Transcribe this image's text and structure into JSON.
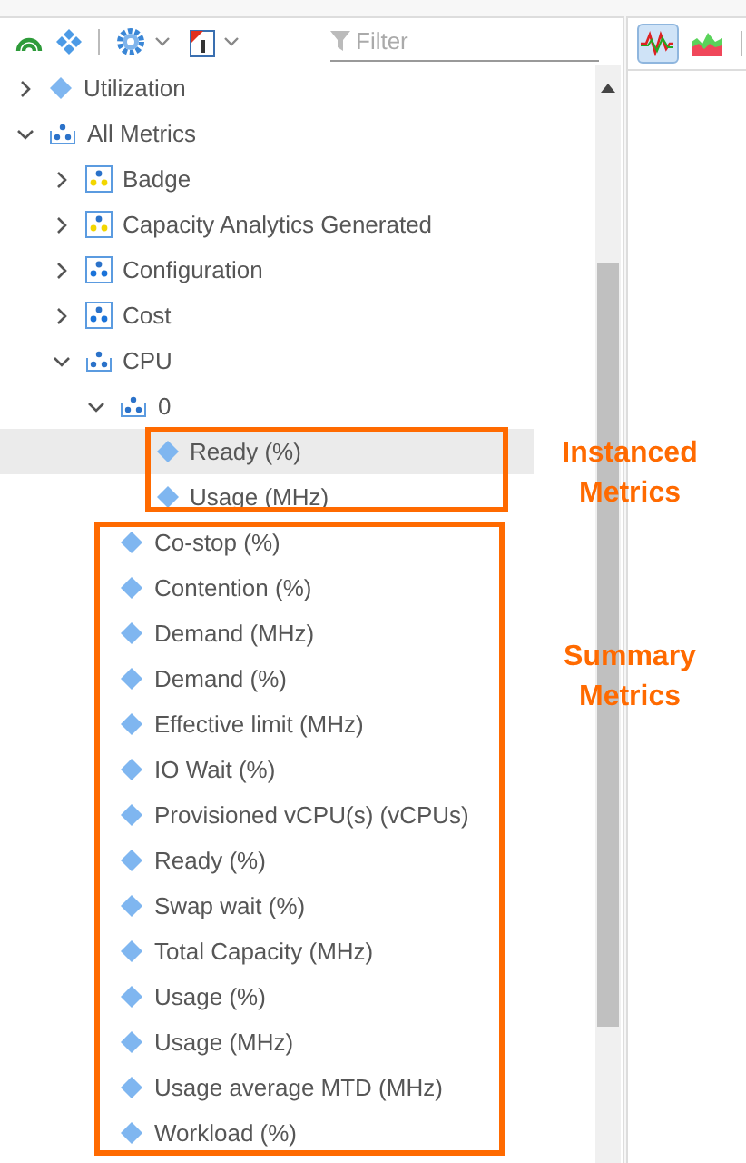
{
  "toolbar": {
    "filter_placeholder": "Filter"
  },
  "chart_buttons": [
    {
      "kind": "line",
      "selected": true
    },
    {
      "kind": "area",
      "selected": false
    }
  ],
  "tree": [
    {
      "label": "Utilization",
      "kind": "metric",
      "expanded": false
    },
    {
      "label": "All Metrics",
      "kind": "group",
      "expanded": true,
      "children": [
        {
          "label": "Badge",
          "kind": "category",
          "color": "#f2d600",
          "expanded": false
        },
        {
          "label": "Capacity Analytics Generated",
          "kind": "category",
          "color": "#f2d600",
          "expanded": false
        },
        {
          "label": "Configuration",
          "kind": "category",
          "color": "#1a73d9",
          "expanded": false
        },
        {
          "label": "Cost",
          "kind": "category",
          "color": "#1a73d9",
          "expanded": false
        },
        {
          "label": "CPU",
          "kind": "group",
          "expanded": true,
          "children": [
            {
              "label": "0",
              "kind": "group",
              "expanded": true,
              "children": [
                {
                  "label": "Ready (%)",
                  "kind": "metric",
                  "selected": true
                },
                {
                  "label": "Usage (MHz)",
                  "kind": "metric",
                  "selected": false
                }
              ]
            },
            {
              "label": "Co-stop (%)",
              "kind": "metric",
              "selected": false
            },
            {
              "label": "Contention (%)",
              "kind": "metric",
              "selected": false
            },
            {
              "label": "Demand (MHz)",
              "kind": "metric",
              "selected": false
            },
            {
              "label": "Demand (%)",
              "kind": "metric",
              "selected": false
            },
            {
              "label": "Effective limit (MHz)",
              "kind": "metric",
              "selected": false
            },
            {
              "label": "IO Wait (%)",
              "kind": "metric",
              "selected": false
            },
            {
              "label": "Provisioned vCPU(s) (vCPUs)",
              "kind": "metric",
              "selected": false
            },
            {
              "label": "Ready (%)",
              "kind": "metric",
              "selected": false
            },
            {
              "label": "Swap wait (%)",
              "kind": "metric",
              "selected": false
            },
            {
              "label": "Total Capacity (MHz)",
              "kind": "metric",
              "selected": false
            },
            {
              "label": "Usage (%)",
              "kind": "metric",
              "selected": false
            },
            {
              "label": "Usage (MHz)",
              "kind": "metric",
              "selected": false
            },
            {
              "label": "Usage average MTD (MHz)",
              "kind": "metric",
              "selected": false
            },
            {
              "label": "Workload (%)",
              "kind": "metric",
              "selected": false
            }
          ]
        }
      ]
    }
  ],
  "annotations": [
    {
      "label": "Instanced Metrics"
    },
    {
      "label": "Summary Metrics"
    }
  ]
}
